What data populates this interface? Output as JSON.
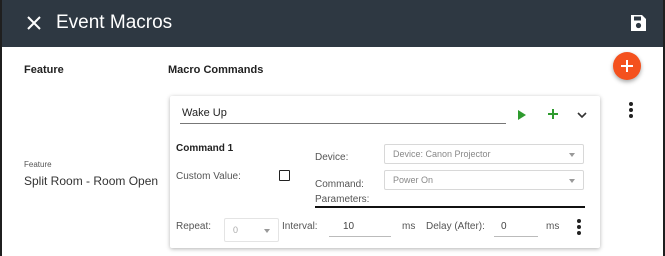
{
  "header": {
    "title": "Event Macros",
    "close_icon": "close-icon",
    "save_icon": "save-icon"
  },
  "columns": {
    "feature": "Feature",
    "macro_commands": "Macro Commands"
  },
  "feature_field": {
    "caption": "Feature",
    "value": "Split Room - Room Open"
  },
  "macro": {
    "name": "Wake Up",
    "command": {
      "title": "Command 1",
      "custom_value_label": "Custom Value:",
      "custom_value_checked": false,
      "device_label": "Device:",
      "device_value": "Device: Canon Projector",
      "command_label": "Command:",
      "command_value": "Power On",
      "parameters_label": "Parameters:",
      "repeat_label": "Repeat:",
      "repeat_value": "0",
      "interval_label": "Interval:",
      "interval_value": "10",
      "interval_unit": "ms",
      "delay_label": "Delay (After):",
      "delay_value": "0",
      "delay_unit": "ms"
    }
  },
  "colors": {
    "header_bg": "#2e3842",
    "fab": "#f4511e",
    "action_green": "#2e9b2e"
  }
}
